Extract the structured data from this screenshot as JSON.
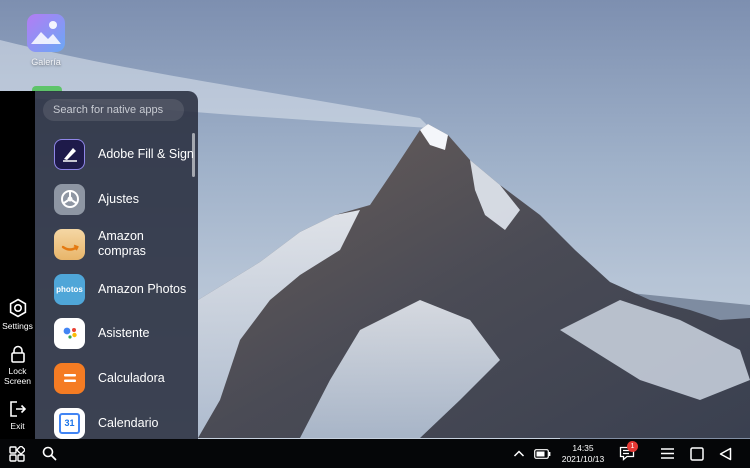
{
  "desktop": {
    "icons": [
      {
        "label": "Galería",
        "icon": "gallery-icon"
      }
    ]
  },
  "side_bar": {
    "items": [
      {
        "label": "Settings",
        "icon": "settings-icon"
      },
      {
        "label": "Lock Screen",
        "icon": "lock-icon"
      },
      {
        "label": "Exit",
        "icon": "exit-icon"
      }
    ]
  },
  "drawer": {
    "search_placeholder": "Search for native apps",
    "apps": [
      {
        "name": "Adobe Fill & Sign",
        "icon": "adobe-fill-sign-icon"
      },
      {
        "name": "Ajustes",
        "icon": "ajustes-icon"
      },
      {
        "name": "Amazon compras",
        "icon": "amazon-compras-icon"
      },
      {
        "name": "Amazon Photos",
        "icon": "amazon-photos-icon"
      },
      {
        "name": "Asistente",
        "icon": "asistente-icon"
      },
      {
        "name": "Calculadora",
        "icon": "calculadora-icon"
      },
      {
        "name": "Calendario",
        "icon": "calendario-icon"
      }
    ]
  },
  "icon_text": {
    "amazon_photos": "photos",
    "calendar_day": "31"
  },
  "taskbar": {
    "time": "14:35",
    "date": "2021/10/13",
    "notification_count": "1",
    "icons": [
      "start-icon",
      "search-icon",
      "chevron-up-icon",
      "battery-icon",
      "notification-icon",
      "menu-icon",
      "recents-icon",
      "back-icon"
    ]
  },
  "colors": {
    "drawer_bg": "#2c3242",
    "taskbar_bg": "#050608",
    "side_bar_bg": "#000000",
    "badge": "#e53935"
  }
}
